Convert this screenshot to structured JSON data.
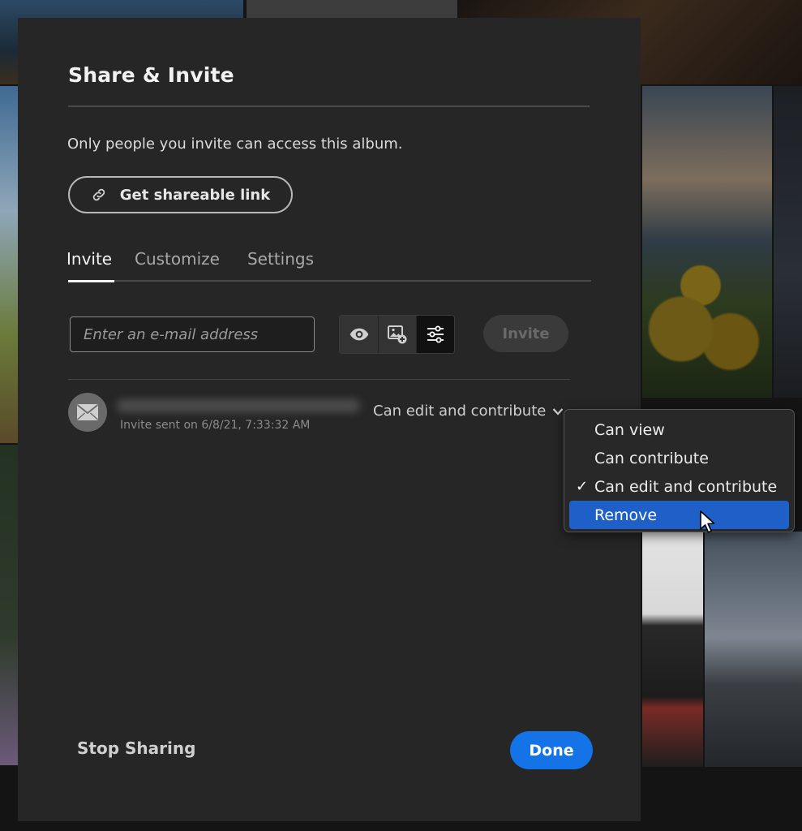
{
  "dialog": {
    "title": "Share & Invite",
    "description": "Only people you invite can access this album.",
    "link_button": {
      "label": "Get shareable link",
      "icon": "link-icon"
    },
    "tabs": [
      {
        "label": "Invite",
        "selected": true
      },
      {
        "label": "Customize",
        "selected": false
      },
      {
        "label": "Settings",
        "selected": false
      }
    ],
    "invite_form": {
      "email_placeholder": "Enter an e-mail address",
      "permission_icons": [
        "eye-icon",
        "add-photo-icon",
        "sliders-icon"
      ],
      "selected_permission": "sliders-icon",
      "invite_label": "Invite"
    },
    "invitee": {
      "avatar_icon": "mail-icon",
      "sent_text": "Invite sent on 6/8/21, 7:33:32 AM",
      "role": "Can edit and contribute"
    },
    "stop_label": "Stop Sharing",
    "done_label": "Done"
  },
  "menu": {
    "items": [
      {
        "label": "Can view",
        "checked": false,
        "highlighted": false
      },
      {
        "label": "Can contribute",
        "checked": false,
        "highlighted": false
      },
      {
        "label": "Can edit and contribute",
        "checked": true,
        "highlighted": false
      },
      {
        "label": "Remove",
        "checked": false,
        "highlighted": true
      }
    ],
    "check_glyph": "✓"
  },
  "colors": {
    "accent": "#1473e6",
    "menu_highlight": "#1f5fc8",
    "dialog_bg": "#262626"
  }
}
